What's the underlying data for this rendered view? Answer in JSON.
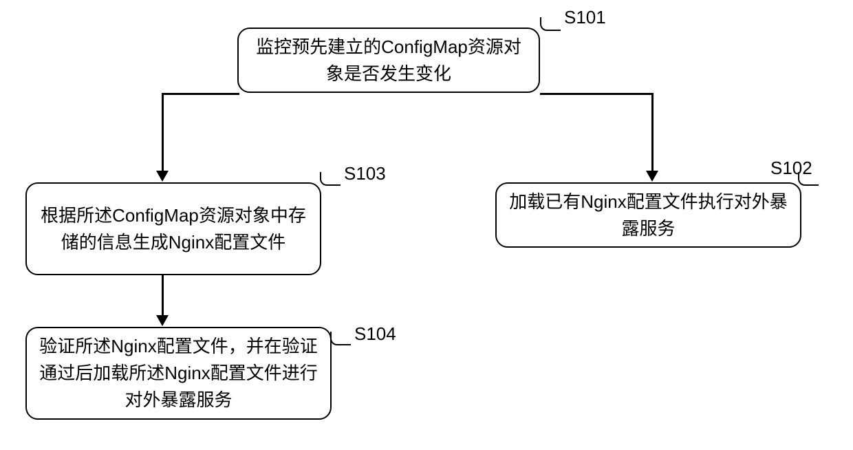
{
  "chart_data": {
    "type": "flowchart",
    "nodes": [
      {
        "id": "S101",
        "text": "监控预先建立的ConfigMap资源对象是否发生变化"
      },
      {
        "id": "S102",
        "text": "加载已有Nginx配置文件执行对外暴露服务"
      },
      {
        "id": "S103",
        "text": "根据所述ConfigMap资源对象中存储的信息生成Nginx配置文件"
      },
      {
        "id": "S104",
        "text": "验证所述Nginx配置文件，并在验证通过后加载所述Nginx配置文件进行对外暴露服务"
      }
    ],
    "edges": [
      {
        "from": "S101",
        "to": "S103"
      },
      {
        "from": "S101",
        "to": "S102"
      },
      {
        "from": "S103",
        "to": "S104"
      }
    ]
  },
  "labels": {
    "s101": "S101",
    "s102": "S102",
    "s103": "S103",
    "s104": "S104"
  }
}
